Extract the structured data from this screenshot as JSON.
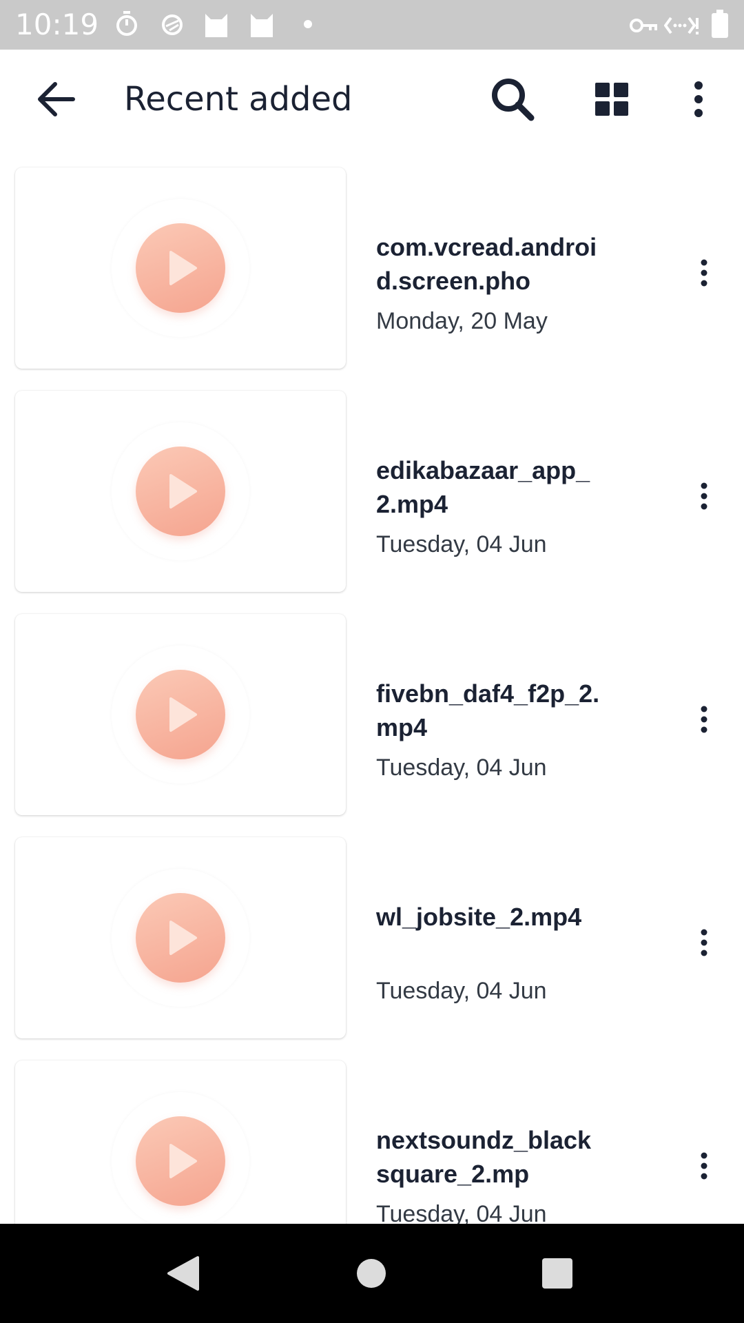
{
  "status_bar": {
    "time": "10:19",
    "icons": [
      "stopwatch-icon",
      "sync-icon",
      "cat-icon",
      "cat-icon",
      "dot-icon",
      "vpn-key-icon",
      "data-saver-icon",
      "battery-icon"
    ]
  },
  "app_bar": {
    "title": "Recent added",
    "back_icon": "arrow-back-icon",
    "actions": [
      "search-icon",
      "grid-view-icon",
      "more-vert-icon"
    ]
  },
  "items": [
    {
      "title": "com.vcread.android.screen.pho",
      "date": "Monday, 20 May"
    },
    {
      "title": "edikabazaar_app_2.mp4",
      "date": "Tuesday, 04 Jun"
    },
    {
      "title": "fivebn_daf4_f2p_2.mp4",
      "date": "Tuesday, 04 Jun"
    },
    {
      "title": "wl_jobsite_2.mp4",
      "date": "Tuesday, 04 Jun"
    },
    {
      "title": "nextsoundz_blacksquare_2.mp",
      "date": "Tuesday, 04 Jun"
    }
  ],
  "colors": {
    "status_bar": "#c9c9c9",
    "text": "#1b2233",
    "play_button": "#f7b3a0",
    "nav_bar": "#000000"
  },
  "nav_bar": [
    "nav-back-icon",
    "nav-home-icon",
    "nav-recents-icon"
  ]
}
